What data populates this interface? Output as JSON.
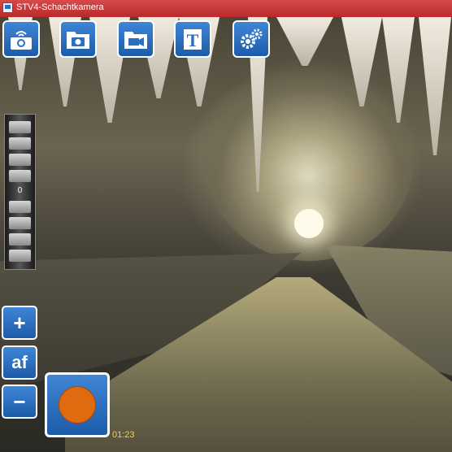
{
  "window": {
    "title": "STV4-Schachtkamera"
  },
  "toolbar": {
    "buttons": [
      {
        "name": "wifi-camera-button",
        "icon": "wifi-camera-icon"
      },
      {
        "name": "photo-folder-button",
        "icon": "photo-folder-icon"
      },
      {
        "name": "video-folder-button",
        "icon": "video-folder-icon"
      },
      {
        "name": "text-button",
        "icon": "text-document-icon",
        "glyph": "T"
      },
      {
        "name": "settings-button",
        "icon": "gears-icon"
      }
    ]
  },
  "zoom": {
    "scale_marker": "0",
    "zoom_in_label": "+",
    "autofocus_label": "af",
    "zoom_out_label": "−"
  },
  "record": {
    "icon": "record-icon",
    "color": "#e06a10"
  },
  "overlay": {
    "timestamp": "01:23"
  },
  "colors": {
    "titlebar": "#c73535",
    "button_blue": "#2d6fc0",
    "button_border": "#ffffff",
    "timestamp": "#f5d24a"
  }
}
